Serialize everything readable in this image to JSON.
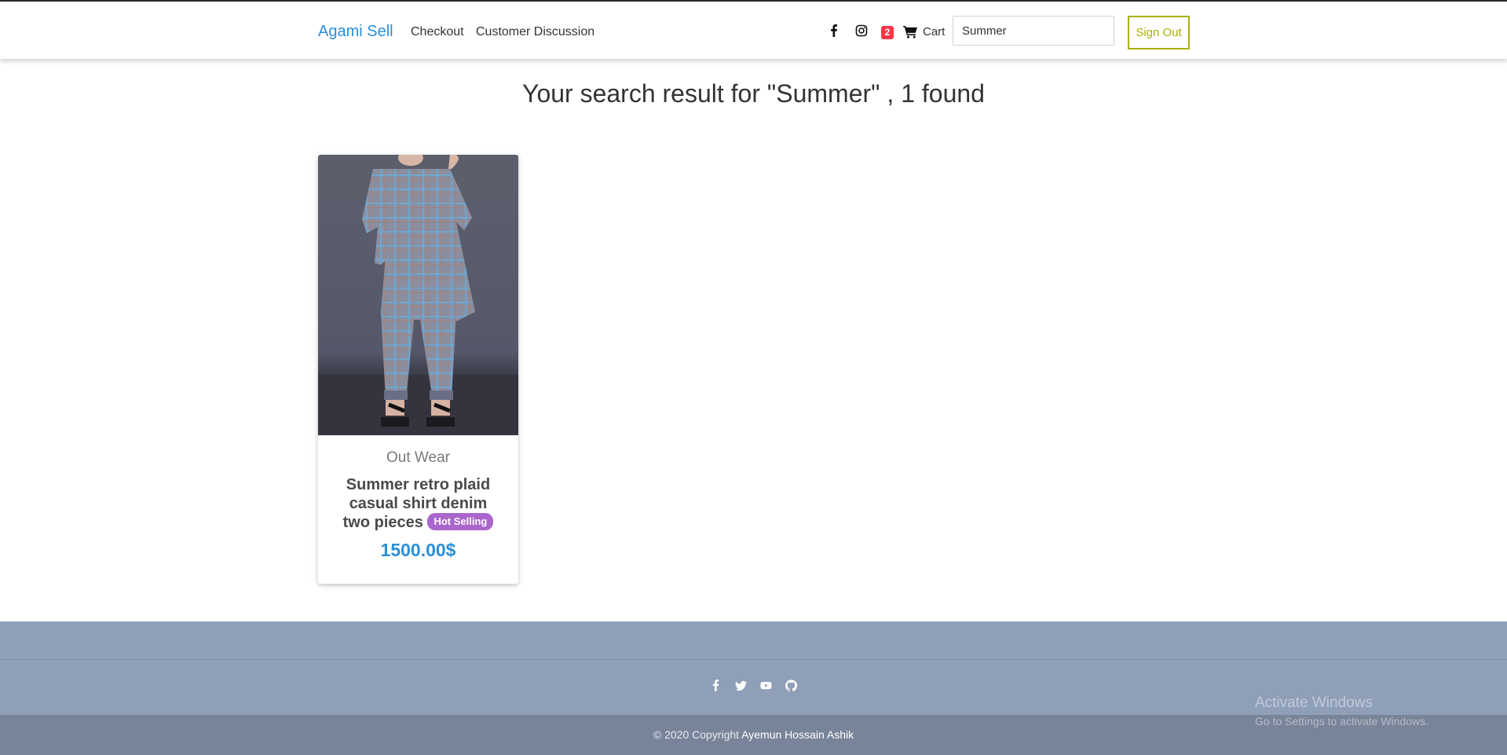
{
  "navbar": {
    "brand": "Agami Sell",
    "links": [
      "Checkout",
      "Customer Discussion"
    ],
    "icons": [
      "facebook-icon",
      "instagram-icon",
      "shopping-cart-icon"
    ],
    "cart_count": "2",
    "cart_label": "Cart",
    "search_value": "Summer",
    "signout_label": "Sign Out"
  },
  "search": {
    "result_title": "Your search result for \"Summer\" , 1 found"
  },
  "products": [
    {
      "category": "Out Wear",
      "name": "Summer retro plaid casual shirt denim two pieces",
      "badge": "Hot Selling",
      "price": "1500.00$"
    }
  ],
  "footer": {
    "social_icons": [
      "facebook-icon",
      "twitter-icon",
      "youtube-icon",
      "github-icon"
    ],
    "copyright": "© 2020 Copyright",
    "author": "Ayemun Hossain Ashik"
  },
  "watermark": {
    "line1": "Activate Windows",
    "line2": "Go to Settings to activate Windows."
  },
  "colors": {
    "brand": "#2a8fd8",
    "badge": "#aa66cc",
    "cart_badge": "#ff3547",
    "signout": "#a8b109",
    "footer": "#8f9fb8",
    "footer_bottom": "#78849a"
  }
}
